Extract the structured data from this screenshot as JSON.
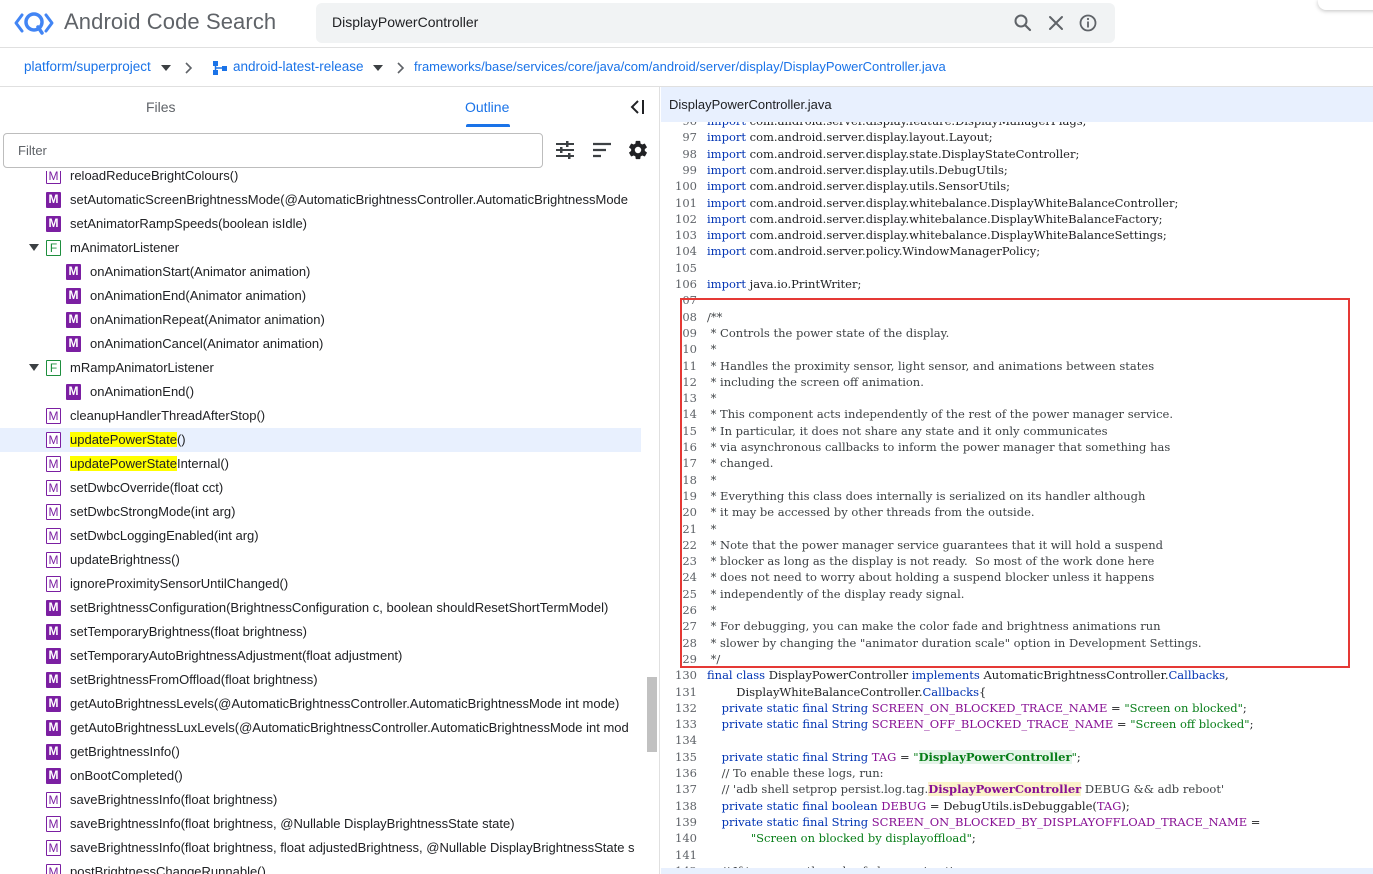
{
  "header": {
    "title": "Android Code Search",
    "search_query": "DisplayPowerController"
  },
  "breadcrumb": {
    "project": "platform/superproject",
    "branch": "android-latest-release",
    "path": "frameworks/base/services/core/java/com/android/server/display/DisplayPowerController.java"
  },
  "left_panel": {
    "tabs": [
      "Files",
      "Outline"
    ],
    "active_tab": "Outline",
    "filter_placeholder": "Filter",
    "items": [
      {
        "kind": "M",
        "outline": true,
        "indent": 0,
        "label": "reloadReduceBrightColours()"
      },
      {
        "kind": "M",
        "outline": false,
        "indent": 0,
        "label": "setAutomaticScreenBrightnessMode(@AutomaticBrightnessController.AutomaticBrightnessMode"
      },
      {
        "kind": "M",
        "outline": false,
        "indent": 0,
        "label": "setAnimatorRampSpeeds(boolean isIdle)"
      },
      {
        "kind": "F",
        "outline": true,
        "indent": 0,
        "expanded": true,
        "label": "mAnimatorListener"
      },
      {
        "kind": "M",
        "outline": false,
        "indent": 1,
        "label": "onAnimationStart(Animator animation)"
      },
      {
        "kind": "M",
        "outline": false,
        "indent": 1,
        "label": "onAnimationEnd(Animator animation)"
      },
      {
        "kind": "M",
        "outline": false,
        "indent": 1,
        "label": "onAnimationRepeat(Animator animation)"
      },
      {
        "kind": "M",
        "outline": false,
        "indent": 1,
        "label": "onAnimationCancel(Animator animation)"
      },
      {
        "kind": "F",
        "outline": true,
        "indent": 0,
        "expanded": true,
        "label": "mRampAnimatorListener"
      },
      {
        "kind": "M",
        "outline": false,
        "indent": 1,
        "label": "onAnimationEnd()"
      },
      {
        "kind": "M",
        "outline": true,
        "indent": 0,
        "label": "cleanupHandlerThreadAfterStop()"
      },
      {
        "kind": "M",
        "outline": true,
        "indent": 0,
        "selected": true,
        "highlight": "updatePowerState",
        "label": "()"
      },
      {
        "kind": "M",
        "outline": true,
        "indent": 0,
        "highlight": "updatePowerState",
        "label": "Internal()"
      },
      {
        "kind": "M",
        "outline": true,
        "indent": 0,
        "label": "setDwbcOverride(float cct)"
      },
      {
        "kind": "M",
        "outline": true,
        "indent": 0,
        "label": "setDwbcStrongMode(int arg)"
      },
      {
        "kind": "M",
        "outline": true,
        "indent": 0,
        "label": "setDwbcLoggingEnabled(int arg)"
      },
      {
        "kind": "M",
        "outline": true,
        "indent": 0,
        "label": "updateBrightness()"
      },
      {
        "kind": "M",
        "outline": true,
        "indent": 0,
        "label": "ignoreProximitySensorUntilChanged()"
      },
      {
        "kind": "M",
        "outline": false,
        "indent": 0,
        "label": "setBrightnessConfiguration(BrightnessConfiguration c, boolean shouldResetShortTermModel)"
      },
      {
        "kind": "M",
        "outline": false,
        "indent": 0,
        "label": "setTemporaryBrightness(float brightness)"
      },
      {
        "kind": "M",
        "outline": false,
        "indent": 0,
        "label": "setTemporaryAutoBrightnessAdjustment(float adjustment)"
      },
      {
        "kind": "M",
        "outline": false,
        "indent": 0,
        "label": "setBrightnessFromOffload(float brightness)"
      },
      {
        "kind": "M",
        "outline": false,
        "indent": 0,
        "label": "getAutoBrightnessLevels(@AutomaticBrightnessController.AutomaticBrightnessMode int mode)"
      },
      {
        "kind": "M",
        "outline": false,
        "indent": 0,
        "label": "getAutoBrightnessLuxLevels(@AutomaticBrightnessController.AutomaticBrightnessMode int mod"
      },
      {
        "kind": "M",
        "outline": false,
        "indent": 0,
        "label": "getBrightnessInfo()"
      },
      {
        "kind": "M",
        "outline": false,
        "indent": 0,
        "label": "onBootCompleted()"
      },
      {
        "kind": "M",
        "outline": true,
        "indent": 0,
        "label": "saveBrightnessInfo(float brightness)"
      },
      {
        "kind": "M",
        "outline": true,
        "indent": 0,
        "label": "saveBrightnessInfo(float brightness, @Nullable DisplayBrightnessState state)"
      },
      {
        "kind": "M",
        "outline": true,
        "indent": 0,
        "label": "saveBrightnessInfo(float brightness, float adjustedBrightness, @Nullable DisplayBrightnessState s"
      },
      {
        "kind": "M",
        "outline": true,
        "indent": 0,
        "label": "postBrightnessChangeRunnable()"
      }
    ]
  },
  "right_panel": {
    "file_name": "DisplayPowerController.java",
    "code_lines": [
      {
        "n": "96",
        "t": "import com.android.server.display.feature.DisplayManagerFlags;"
      },
      {
        "n": "97",
        "t": "import com.android.server.display.layout.Layout;"
      },
      {
        "n": "98",
        "t": "import com.android.server.display.state.DisplayStateController;"
      },
      {
        "n": "99",
        "t": "import com.android.server.display.utils.DebugUtils;"
      },
      {
        "n": "100",
        "t": "import com.android.server.display.utils.SensorUtils;"
      },
      {
        "n": "101",
        "t": "import com.android.server.display.whitebalance.DisplayWhiteBalanceController;"
      },
      {
        "n": "102",
        "t": "import com.android.server.display.whitebalance.DisplayWhiteBalanceFactory;"
      },
      {
        "n": "103",
        "t": "import com.android.server.display.whitebalance.DisplayWhiteBalanceSettings;"
      },
      {
        "n": "104",
        "t": "import com.android.server.policy.WindowManagerPolicy;"
      },
      {
        "n": "105",
        "t": ""
      },
      {
        "n": "106",
        "t": "import java.io.PrintWriter;"
      },
      {
        "n": "07",
        "t": ""
      },
      {
        "n": "08",
        "t": "/**"
      },
      {
        "n": "09",
        "t": " * Controls the power state of the display."
      },
      {
        "n": "10",
        "t": " *"
      },
      {
        "n": "11",
        "t": " * Handles the proximity sensor, light sensor, and animations between states"
      },
      {
        "n": "12",
        "t": " * including the screen off animation."
      },
      {
        "n": "13",
        "t": " *"
      },
      {
        "n": "14",
        "t": " * This component acts independently of the rest of the power manager service."
      },
      {
        "n": "15",
        "t": " * In particular, it does not share any state and it only communicates"
      },
      {
        "n": "16",
        "t": " * via asynchronous callbacks to inform the power manager that something has"
      },
      {
        "n": "17",
        "t": " * changed."
      },
      {
        "n": "18",
        "t": " *"
      },
      {
        "n": "19",
        "t": " * Everything this class does internally is serialized on its handler although"
      },
      {
        "n": "20",
        "t": " * it may be accessed by other threads from the outside."
      },
      {
        "n": "21",
        "t": " *"
      },
      {
        "n": "22",
        "t": " * Note that the power manager service guarantees that it will hold a suspend"
      },
      {
        "n": "23",
        "t": " * blocker as long as the display is not ready.  So most of the work done here"
      },
      {
        "n": "24",
        "t": " * does not need to worry about holding a suspend blocker unless it happens"
      },
      {
        "n": "25",
        "t": " * independently of the display ready signal."
      },
      {
        "n": "26",
        "t": " *"
      },
      {
        "n": "27",
        "t": " * For debugging, you can make the color fade and brightness animations run"
      },
      {
        "n": "28",
        "t": " * slower by changing the \"animator duration scale\" option in Development Settings."
      },
      {
        "n": "29",
        "t": " */"
      },
      {
        "n": "130",
        "t": "final class DisplayPowerController implements AutomaticBrightnessController.Callbacks,"
      },
      {
        "n": "131",
        "t": "        DisplayWhiteBalanceController.Callbacks{"
      },
      {
        "n": "132",
        "t": "    private static final String SCREEN_ON_BLOCKED_TRACE_NAME = \"Screen on blocked\";"
      },
      {
        "n": "133",
        "t": "    private static final String SCREEN_OFF_BLOCKED_TRACE_NAME = \"Screen off blocked\";"
      },
      {
        "n": "134",
        "t": ""
      },
      {
        "n": "135",
        "t": "    private static final String TAG = \"DisplayPowerController\";"
      },
      {
        "n": "136",
        "t": "    // To enable these logs, run:"
      },
      {
        "n": "137",
        "t": "    // 'adb shell setprop persist.log.tag.DisplayPowerController DEBUG && adb reboot'"
      },
      {
        "n": "138",
        "t": "    private static final boolean DEBUG = DebugUtils.isDebuggable(TAG);"
      },
      {
        "n": "139",
        "t": "    private static final String SCREEN_ON_BLOCKED_BY_DISPLAYOFFLOAD_TRACE_NAME ="
      },
      {
        "n": "140",
        "t": "            \"Screen on blocked by displayoffload\";"
      },
      {
        "n": "141",
        "t": ""
      },
      {
        "n": "142",
        "t": "    // If true, uses the color fade on animation."
      }
    ]
  },
  "colors": {
    "accent": "#1a73e8",
    "method_badge": "#7b1fa2",
    "field_badge": "#1e8e3e",
    "selection": "#e8f0fe",
    "search_highlight": "#ffff00",
    "annotation_box": "#e53935"
  },
  "icons": {
    "logo": "code-search-logo-icon",
    "search": "search-icon",
    "clear": "close-icon",
    "info": "info-icon",
    "collapse": "collapse-panel-icon",
    "tune": "tune-icon",
    "sort": "sort-icon",
    "settings": "gear-icon"
  }
}
